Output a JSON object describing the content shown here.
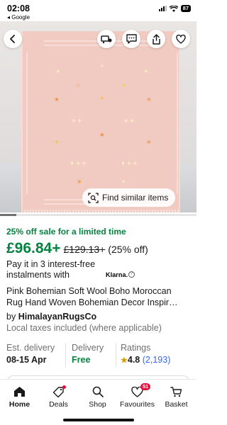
{
  "status_bar": {
    "time": "02:08",
    "back_app": "◂ Google",
    "battery": "87"
  },
  "image_overlay": {
    "similar_label": "Find similar items"
  },
  "listing": {
    "sale_banner": "25% off sale for a limited time",
    "price": "£96.84+",
    "original_price": "£129.13+",
    "discount": "(25% off)",
    "instalments_line1": "Pay it in 3 interest-free",
    "instalments_line2": "instalments with",
    "klarna": "Klarna.",
    "title_line1": "Pink Bohemian Soft Wool Boho Moroccan",
    "title_line2": "Rug Hand Woven Bohemian Decor Inspir…",
    "seller_prefix": "by ",
    "seller_name": "HimalayanRugsCo",
    "taxes": "Local taxes included (where applicable)"
  },
  "facts": {
    "delivery_label": "Est. delivery",
    "delivery_value": "08-15 Apr",
    "shipping_label": "Delivery",
    "shipping_value": "Free",
    "ratings_label": "Ratings",
    "rating_value": "4.8",
    "rating_count": "(2,193)"
  },
  "bottom_nav": {
    "home": "Home",
    "deals": "Deals",
    "shop": "Shop",
    "favourites": "Favourites",
    "favourites_badge": "51",
    "basket": "Basket"
  },
  "colors": {
    "sale_green": "#05823f",
    "link_blue": "#3665f3",
    "badge_red": "#e0103a",
    "rug_pink": "#f1cbc1"
  },
  "icons": [
    "back-arrow-icon",
    "cart-icon",
    "message-icon",
    "share-icon",
    "heart-icon",
    "similar-search-icon",
    "home-icon",
    "deals-tag-icon",
    "search-icon",
    "heart-icon",
    "basket-icon"
  ]
}
